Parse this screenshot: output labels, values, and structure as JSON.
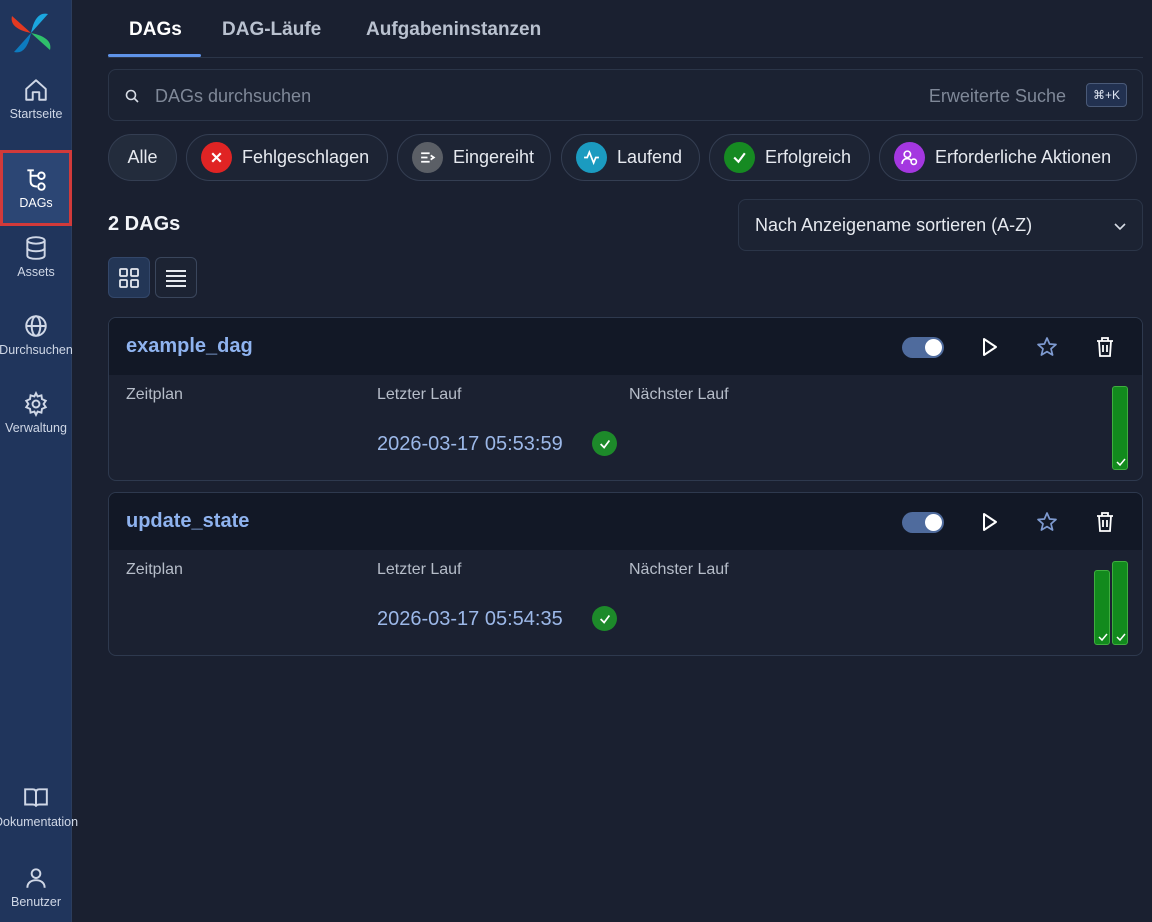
{
  "sidebar": {
    "items": [
      {
        "label": "Startseite",
        "icon": "home-icon"
      },
      {
        "label": "DAGs",
        "icon": "dags-icon",
        "active": true
      },
      {
        "label": "Assets",
        "icon": "database-icon"
      },
      {
        "label": "Durchsuchen",
        "icon": "globe-icon"
      },
      {
        "label": "Verwaltung",
        "icon": "gear-icon"
      }
    ],
    "bottom_items": [
      {
        "label": "Dokumentation",
        "icon": "book-icon"
      },
      {
        "label": "Benutzer",
        "icon": "user-icon"
      }
    ]
  },
  "tabs": [
    {
      "label": "DAGs",
      "active": true
    },
    {
      "label": "DAG-Läufe"
    },
    {
      "label": "Aufgabeninstanzen"
    }
  ],
  "search": {
    "placeholder": "DAGs durchsuchen",
    "advanced_label": "Erweiterte Suche",
    "shortcut": "⌘+K"
  },
  "filters": [
    {
      "label": "Alle"
    },
    {
      "label": "Fehlgeschlagen",
      "color": "#e02424",
      "icon": "x-icon"
    },
    {
      "label": "Eingereiht",
      "color": "#5b5f66",
      "icon": "queue-icon"
    },
    {
      "label": "Laufend",
      "color": "#1b9bc0",
      "icon": "activity-icon"
    },
    {
      "label": "Erfolgreich",
      "color": "#168a22",
      "icon": "check-icon"
    },
    {
      "label": "Erforderliche Aktionen",
      "color": "#a437e0",
      "icon": "user-action-icon"
    }
  ],
  "dag_count": "2 DAGs",
  "sort": {
    "selected": "Nach Anzeigename sortieren (A-Z)"
  },
  "dags": [
    {
      "name": "example_dag",
      "columns": {
        "schedule": "Zeitplan",
        "last_run": "Letzter Lauf",
        "next_run": "Nächster Lauf"
      },
      "last_run_value": "2026-03-17 05:53:59",
      "status": "success",
      "active": true,
      "runs": 1
    },
    {
      "name": "update_state",
      "columns": {
        "schedule": "Zeitplan",
        "last_run": "Letzter Lauf",
        "next_run": "Nächster Lauf"
      },
      "last_run_value": "2026-03-17 05:54:35",
      "status": "success",
      "active": true,
      "runs": 2
    }
  ],
  "colors": {
    "accent": "#5f93e8",
    "success": "#168a22",
    "sidebar": "#20355c",
    "background": "#1a2030"
  }
}
